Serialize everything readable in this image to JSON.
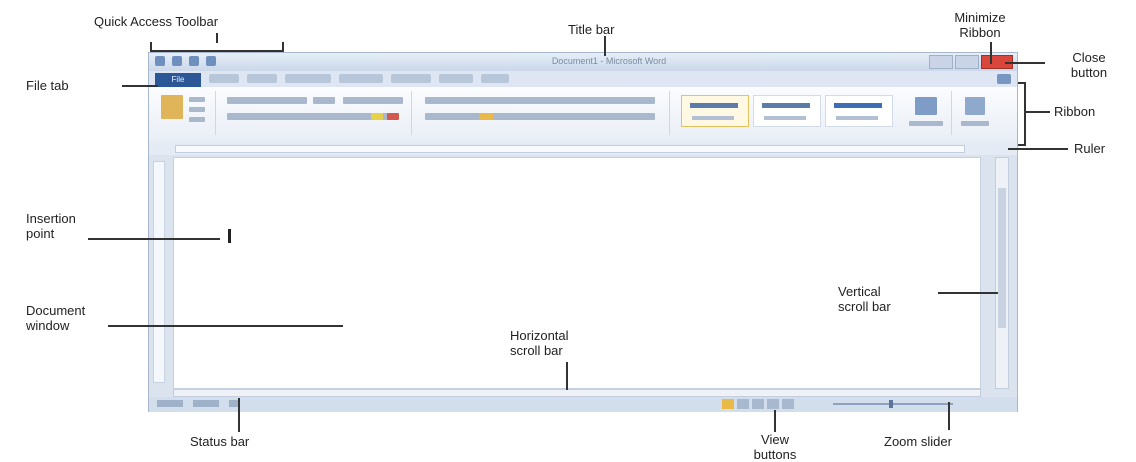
{
  "window": {
    "title": "Document1 - Microsoft Word",
    "file_tab": "File"
  },
  "labels": {
    "quick_access_toolbar": "Quick Access Toolbar",
    "title_bar": "Title bar",
    "minimize_ribbon": [
      "Minimize",
      "Ribbon"
    ],
    "close_button": [
      "Close",
      "button"
    ],
    "file_tab": "File tab",
    "ribbon": "Ribbon",
    "ruler": "Ruler",
    "insertion_point": [
      "Insertion",
      "point"
    ],
    "document_window": [
      "Document",
      "window"
    ],
    "vertical_scroll_bar": [
      "Vertical",
      "scroll bar"
    ],
    "horizontal_scroll_bar": [
      "Horizontal",
      "scroll bar"
    ],
    "status_bar": "Status bar",
    "view_buttons": [
      "View",
      "buttons"
    ],
    "zoom_slider": "Zoom slider"
  },
  "colors": {
    "file_tab": "#2b5797",
    "close_button": "#d9463b",
    "active_view_button": "#e9b949",
    "annotation_line": "#333333"
  }
}
